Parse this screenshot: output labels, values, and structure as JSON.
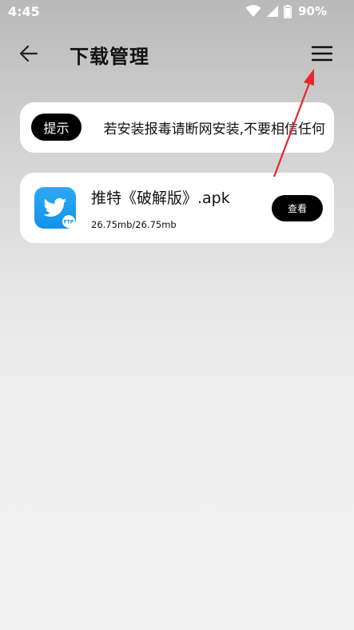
{
  "status_bar": {
    "time": "4:45",
    "battery": "90%"
  },
  "header": {
    "title": "下载管理"
  },
  "notice": {
    "tag": "提示",
    "text": "若安装报毒请断网安装,不要相信任何"
  },
  "downloads": [
    {
      "name": "推特《破解版》.apk",
      "size": "26.75mb/26.75mb",
      "action": "查看",
      "icon": "twitter-app-icon"
    }
  ],
  "colors": {
    "annotation_arrow": "#e8262b",
    "twitter_blue": "#1da1f2"
  }
}
